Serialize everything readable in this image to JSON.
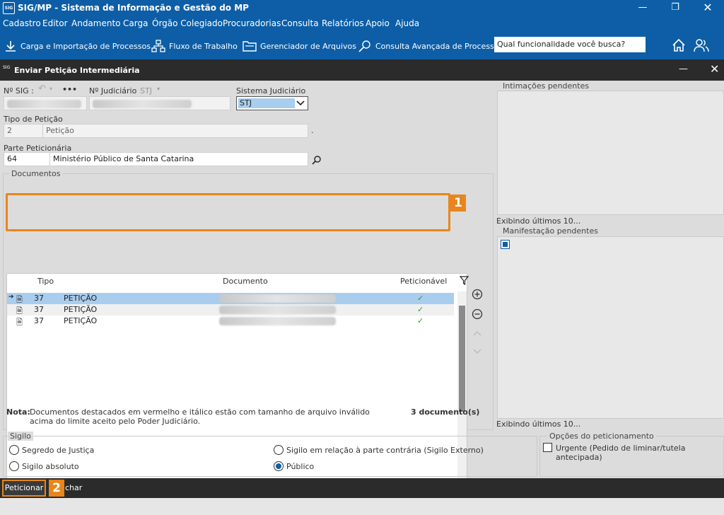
{
  "window": {
    "logo_text": "SIG",
    "title": "SIG/MP - Sistema de Informação e Gestão do MP"
  },
  "menu": [
    "Cadastro",
    "Editor",
    "Andamento",
    "Carga",
    "Órgão Colegiado",
    "Procuradorias",
    "Consulta",
    "Relatórios",
    "Apoio",
    "Ajuda"
  ],
  "toolbar": {
    "btn1": "Carga e Importação de Processos",
    "btn2": "Fluxo de Trabalho",
    "btn3": "Gerenciador de Arquivos",
    "btn4": "Consulta Avançada de Processos",
    "search_value": "Qual funcionalidade você busca?"
  },
  "dialog": {
    "title": "Enviar Petição Intermediária",
    "n_sig_label": "Nº SIG :",
    "n_sig_more": "•••",
    "n_judiciario_label": "Nº Judiciário",
    "n_judiciario_value": "STJ",
    "sistema_label": "Sistema Judiciário",
    "sistema_value": "STJ",
    "tipo_label": "Tipo de Petição",
    "tipo_code": "2",
    "tipo_value": "Petição",
    "tipo_dot": ".",
    "parte_label": "Parte Peticionária",
    "parte_code": "64",
    "parte_value": "Ministério Público de Santa Catarina"
  },
  "documents": {
    "group_title": "Documentos",
    "columns": {
      "tipo": "Tipo",
      "documento": "Documento",
      "peticionavel": "Peticionável"
    },
    "rows": [
      {
        "code": "37",
        "tipo": "PETIÇÃO",
        "check": "✓"
      },
      {
        "code": "37",
        "tipo": "PETIÇÃO",
        "check": "✓"
      },
      {
        "code": "37",
        "tipo": "PETIÇÃO",
        "check": "✓"
      }
    ],
    "note_label": "Nota:",
    "note_text": "Documentos destacados em vermelho e itálico estão com tamanho de arquivo inválido",
    "note_text2": "acima do limite aceito pelo Poder Judiciário.",
    "count": "3 documento(s)"
  },
  "right": {
    "intimacoes_title": "Intimações pendentes",
    "intimacoes_footer": "Exibindo últimos 10...",
    "manifestacao_title": "Manifestação pendentes",
    "manifestacao_footer": "Exibindo últimos 10..."
  },
  "sigilo": {
    "title": "Sigilo",
    "opt1": "Segredo de Justiça",
    "opt2": "Sigilo absoluto",
    "opt3": "Sigilo em relação à parte contrária (Sigilo Externo)",
    "opt4": "Público",
    "selected": "Público"
  },
  "opcoes": {
    "title": "Opções do peticionamento",
    "urgente": "Urgente (Pedido de liminar/tutela antecipada)"
  },
  "bottom": {
    "peticionar": "Peticionar",
    "fechar": "char"
  },
  "callouts": {
    "one": "1",
    "two": "2"
  },
  "colors": {
    "brand": "#0d5ea6",
    "accent": "#e8861e",
    "check": "#2e9e2e"
  }
}
